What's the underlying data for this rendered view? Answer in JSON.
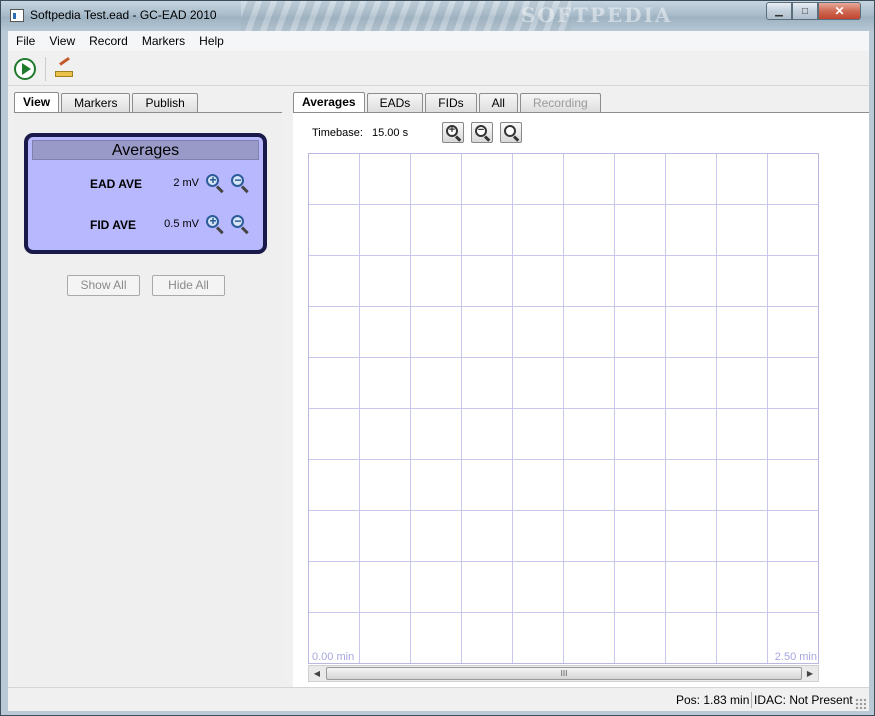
{
  "window": {
    "title": "Softpedia Test.ead - GC-EAD 2010",
    "watermark": "SOFTPEDIA",
    "controls": {
      "minimize": "▁",
      "maximize": "□",
      "close": "✕"
    }
  },
  "menu": [
    "File",
    "View",
    "Record",
    "Markers",
    "Help"
  ],
  "toolbar": {
    "play_icon": "play-circle-icon",
    "edit_icon": "edit-pencil-icon"
  },
  "left_tabs": [
    {
      "label": "View",
      "active": true
    },
    {
      "label": "Markers",
      "active": false
    },
    {
      "label": "Publish",
      "active": false
    }
  ],
  "averages_panel": {
    "title": "Averages",
    "rows": [
      {
        "label": "EAD AVE",
        "value": "2 mV"
      },
      {
        "label": "FID AVE",
        "value": "0.5 mV"
      }
    ],
    "zoom_in_symbol": "+",
    "zoom_out_symbol": "−",
    "show_all": "Show All",
    "hide_all": "Hide All"
  },
  "right_tabs": [
    {
      "label": "Averages",
      "active": true
    },
    {
      "label": "EADs",
      "active": false
    },
    {
      "label": "FIDs",
      "active": false
    },
    {
      "label": "All",
      "active": false
    },
    {
      "label": "Recording",
      "active": false,
      "disabled": true
    }
  ],
  "timebase": {
    "label": "Timebase:",
    "value": "15.00 s"
  },
  "plot": {
    "x_start": "0.00 min",
    "x_end": "2.50 min",
    "grid_color": "#c8c8ee",
    "grid_columns": 10,
    "grid_rows": 10
  },
  "scrollbar": {
    "left": "◀",
    "right": "▶",
    "grip": "III"
  },
  "status": {
    "pos": "Pos: 1.83 min",
    "idac": "IDAC: Not Present"
  },
  "colors": {
    "averages_box": "#b8b8ff",
    "averages_border": "#1a1a4a",
    "axis_label": "#a6a6e0"
  }
}
